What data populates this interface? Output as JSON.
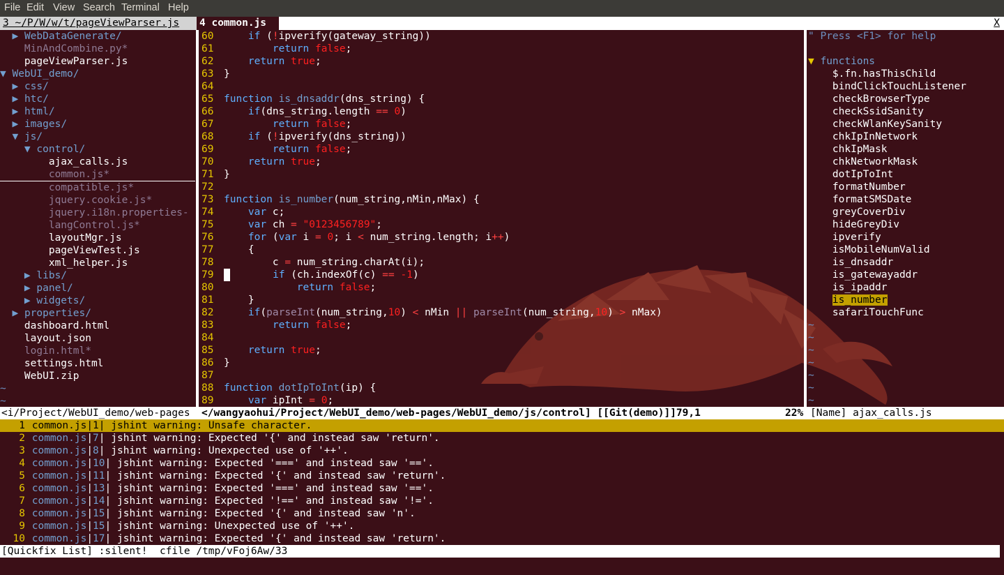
{
  "menubar": [
    "File",
    "Edit",
    "View",
    "Search",
    "Terminal",
    "Help"
  ],
  "tabline": {
    "tab1": "3 ~/P/W/w/t/pageViewParser.js",
    "tab2": "4 common.js",
    "close": "X"
  },
  "tree": [
    {
      "indent": "  ",
      "arrow": "▶ ",
      "text": "WebDataGenerate/",
      "kind": "dir"
    },
    {
      "indent": "    ",
      "arrow": "",
      "text": "MinAndCombine.py*",
      "kind": "mod"
    },
    {
      "indent": "    ",
      "arrow": "",
      "text": "pageViewParser.js",
      "kind": "file"
    },
    {
      "indent": "",
      "arrow": "▼ ",
      "text": "WebUI_demo/",
      "kind": "dir"
    },
    {
      "indent": "  ",
      "arrow": "▶ ",
      "text": "css/",
      "kind": "dir"
    },
    {
      "indent": "  ",
      "arrow": "▶ ",
      "text": "htc/",
      "kind": "dir"
    },
    {
      "indent": "  ",
      "arrow": "▶ ",
      "text": "html/",
      "kind": "dir"
    },
    {
      "indent": "  ",
      "arrow": "▶ ",
      "text": "images/",
      "kind": "dir"
    },
    {
      "indent": "  ",
      "arrow": "▼ ",
      "text": "js/",
      "kind": "dir"
    },
    {
      "indent": "    ",
      "arrow": "▼ ",
      "text": "control/",
      "kind": "dir"
    },
    {
      "indent": "        ",
      "arrow": "",
      "text": "ajax_calls.js",
      "kind": "file"
    },
    {
      "indent": "        ",
      "arrow": "",
      "text": "common.js*",
      "kind": "mod",
      "selected": true
    },
    {
      "indent": "        ",
      "arrow": "",
      "text": "compatible.js*",
      "kind": "mod"
    },
    {
      "indent": "        ",
      "arrow": "",
      "text": "jquery.cookie.js*",
      "kind": "mod"
    },
    {
      "indent": "        ",
      "arrow": "",
      "text": "jquery.i18n.properties-",
      "kind": "mod"
    },
    {
      "indent": "        ",
      "arrow": "",
      "text": "langControl.js*",
      "kind": "mod"
    },
    {
      "indent": "        ",
      "arrow": "",
      "text": "layoutMgr.js",
      "kind": "file"
    },
    {
      "indent": "        ",
      "arrow": "",
      "text": "pageViewTest.js",
      "kind": "file"
    },
    {
      "indent": "        ",
      "arrow": "",
      "text": "xml_helper.js",
      "kind": "file"
    },
    {
      "indent": "    ",
      "arrow": "▶ ",
      "text": "libs/",
      "kind": "dir"
    },
    {
      "indent": "    ",
      "arrow": "▶ ",
      "text": "panel/",
      "kind": "dir"
    },
    {
      "indent": "    ",
      "arrow": "▶ ",
      "text": "widgets/",
      "kind": "dir"
    },
    {
      "indent": "  ",
      "arrow": "▶ ",
      "text": "properties/",
      "kind": "dir"
    },
    {
      "indent": "    ",
      "arrow": "",
      "text": "dashboard.html",
      "kind": "file"
    },
    {
      "indent": "    ",
      "arrow": "",
      "text": "layout.json",
      "kind": "file"
    },
    {
      "indent": "    ",
      "arrow": "",
      "text": "login.html*",
      "kind": "mod"
    },
    {
      "indent": "    ",
      "arrow": "",
      "text": "settings.html",
      "kind": "file"
    },
    {
      "indent": "    ",
      "arrow": "",
      "text": "WebUI.zip",
      "kind": "file"
    },
    {
      "indent": "",
      "arrow": "",
      "text": "~",
      "kind": "tilde"
    },
    {
      "indent": "",
      "arrow": "",
      "text": "~",
      "kind": "tilde"
    }
  ],
  "editor": {
    "cursor_line": 79,
    "lines": [
      {
        "n": "60",
        "segs": [
          [
            "    ",
            ""
          ],
          [
            "if",
            "kw"
          ],
          [
            " (",
            ""
          ],
          [
            "!",
            "op"
          ],
          [
            "ipverify(gateway_string))",
            ""
          ]
        ]
      },
      {
        "n": "61",
        "segs": [
          [
            "        ",
            ""
          ],
          [
            "return",
            "kw"
          ],
          [
            " ",
            ""
          ],
          [
            "false",
            "bool"
          ],
          [
            ";",
            ""
          ]
        ]
      },
      {
        "n": "62",
        "segs": [
          [
            "    ",
            ""
          ],
          [
            "return",
            "kw"
          ],
          [
            " ",
            ""
          ],
          [
            "true",
            "bool"
          ],
          [
            ";",
            ""
          ]
        ]
      },
      {
        "n": "63",
        "segs": [
          [
            "}",
            ""
          ]
        ]
      },
      {
        "n": "64",
        "segs": []
      },
      {
        "n": "65",
        "segs": [
          [
            "function",
            "kw"
          ],
          [
            " ",
            ""
          ],
          [
            "is_dnsaddr",
            "fn"
          ],
          [
            "(dns_string) {",
            ""
          ]
        ]
      },
      {
        "n": "66",
        "segs": [
          [
            "    ",
            ""
          ],
          [
            "if",
            "kw"
          ],
          [
            "(dns_string.length ",
            ""
          ],
          [
            "==",
            "op"
          ],
          [
            " ",
            ""
          ],
          [
            "0",
            "num"
          ],
          [
            ")",
            ""
          ]
        ]
      },
      {
        "n": "67",
        "segs": [
          [
            "        ",
            ""
          ],
          [
            "return",
            "kw"
          ],
          [
            " ",
            ""
          ],
          [
            "false",
            "bool"
          ],
          [
            ";",
            ""
          ]
        ]
      },
      {
        "n": "68",
        "segs": [
          [
            "    ",
            ""
          ],
          [
            "if",
            "kw"
          ],
          [
            " (",
            ""
          ],
          [
            "!",
            "op"
          ],
          [
            "ipverify(dns_string))",
            ""
          ]
        ]
      },
      {
        "n": "69",
        "segs": [
          [
            "        ",
            ""
          ],
          [
            "return",
            "kw"
          ],
          [
            " ",
            ""
          ],
          [
            "false",
            "bool"
          ],
          [
            ";",
            ""
          ]
        ]
      },
      {
        "n": "70",
        "segs": [
          [
            "    ",
            ""
          ],
          [
            "return",
            "kw"
          ],
          [
            " ",
            ""
          ],
          [
            "true",
            "bool"
          ],
          [
            ";",
            ""
          ]
        ]
      },
      {
        "n": "71",
        "segs": [
          [
            "}",
            ""
          ]
        ]
      },
      {
        "n": "72",
        "segs": []
      },
      {
        "n": "73",
        "segs": [
          [
            "function",
            "kw"
          ],
          [
            " ",
            ""
          ],
          [
            "is_number",
            "fn"
          ],
          [
            "(num_string,nMin,nMax) {",
            ""
          ]
        ]
      },
      {
        "n": "74",
        "segs": [
          [
            "    ",
            ""
          ],
          [
            "var",
            "kw"
          ],
          [
            " c;",
            ""
          ]
        ]
      },
      {
        "n": "75",
        "segs": [
          [
            "    ",
            ""
          ],
          [
            "var",
            "kw"
          ],
          [
            " ch ",
            ""
          ],
          [
            "=",
            "op"
          ],
          [
            " ",
            ""
          ],
          [
            "\"0123456789\"",
            "str"
          ],
          [
            ";",
            ""
          ]
        ]
      },
      {
        "n": "76",
        "segs": [
          [
            "    ",
            ""
          ],
          [
            "for",
            "kw"
          ],
          [
            " (",
            ""
          ],
          [
            "var",
            "kw"
          ],
          [
            " i ",
            ""
          ],
          [
            "=",
            "op"
          ],
          [
            " ",
            ""
          ],
          [
            "0",
            "num"
          ],
          [
            "; i ",
            ""
          ],
          [
            "<",
            "op"
          ],
          [
            " num_string.length; i",
            ""
          ],
          [
            "++",
            "op"
          ],
          [
            ")",
            ""
          ]
        ]
      },
      {
        "n": "77",
        "segs": [
          [
            "    {",
            ""
          ]
        ]
      },
      {
        "n": "78",
        "segs": [
          [
            "        c ",
            ""
          ],
          [
            "=",
            "op"
          ],
          [
            " num_string.charAt(i);",
            ""
          ]
        ]
      },
      {
        "n": "79",
        "segs": [
          [
            "        ",
            ""
          ],
          [
            "if",
            "kw"
          ],
          [
            " (ch.indexOf(c) ",
            ""
          ],
          [
            "==",
            "op"
          ],
          [
            " ",
            ""
          ],
          [
            "-1",
            "num"
          ],
          [
            ")",
            ""
          ]
        ]
      },
      {
        "n": "80",
        "segs": [
          [
            "            ",
            ""
          ],
          [
            "return",
            "kw"
          ],
          [
            " ",
            ""
          ],
          [
            "false",
            "bool"
          ],
          [
            ";",
            ""
          ]
        ]
      },
      {
        "n": "81",
        "segs": [
          [
            "    }",
            ""
          ]
        ]
      },
      {
        "n": "82",
        "segs": [
          [
            "    ",
            ""
          ],
          [
            "if",
            "kw"
          ],
          [
            "(",
            ""
          ],
          [
            "parseInt",
            "gray"
          ],
          [
            "(num_string,",
            ""
          ],
          [
            "10",
            "num"
          ],
          [
            ") ",
            ""
          ],
          [
            "<",
            "op"
          ],
          [
            " nMin ",
            ""
          ],
          [
            "||",
            "op"
          ],
          [
            " ",
            ""
          ],
          [
            "parseInt",
            "gray"
          ],
          [
            "(num_string,",
            ""
          ],
          [
            "10",
            "num"
          ],
          [
            ") ",
            ""
          ],
          [
            ">",
            "op"
          ],
          [
            " nMax)",
            ""
          ]
        ]
      },
      {
        "n": "83",
        "segs": [
          [
            "        ",
            ""
          ],
          [
            "return",
            "kw"
          ],
          [
            " ",
            ""
          ],
          [
            "false",
            "bool"
          ],
          [
            ";",
            ""
          ]
        ]
      },
      {
        "n": "84",
        "segs": []
      },
      {
        "n": "85",
        "segs": [
          [
            "    ",
            ""
          ],
          [
            "return",
            "kw"
          ],
          [
            " ",
            ""
          ],
          [
            "true",
            "bool"
          ],
          [
            ";",
            ""
          ]
        ]
      },
      {
        "n": "86",
        "segs": [
          [
            "}",
            ""
          ]
        ]
      },
      {
        "n": "87",
        "segs": []
      },
      {
        "n": "88",
        "segs": [
          [
            "function",
            "kw"
          ],
          [
            " ",
            ""
          ],
          [
            "dotIpToInt",
            "fn"
          ],
          [
            "(ip) {",
            ""
          ]
        ]
      },
      {
        "n": "89",
        "segs": [
          [
            "    ",
            ""
          ],
          [
            "var",
            "kw"
          ],
          [
            " ipInt ",
            ""
          ],
          [
            "=",
            "op"
          ],
          [
            " ",
            ""
          ],
          [
            "0",
            "num"
          ],
          [
            ";",
            ""
          ]
        ]
      }
    ]
  },
  "tagbar": {
    "help": "\" Press <F1> for help",
    "header": "functions",
    "current": "is_number",
    "items": [
      "$.fn.hasThisChild",
      "bindClickTouchListener",
      "checkBrowserType",
      "checkSsidSanity",
      "checkWlanKeySanity",
      "chkIpInNetwork",
      "chkIpMask",
      "chkNetworkMask",
      "dotIpToInt",
      "formatNumber",
      "formatSMSDate",
      "greyCoverDiv",
      "hideGreyDiv",
      "ipverify",
      "isMobileNumValid",
      "is_dnsaddr",
      "is_gatewayaddr",
      "is_ipaddr",
      "is_number",
      "safariTouchFunc"
    ],
    "tilde_count": 7
  },
  "status": {
    "left": "<i/Project/WebUI_demo/web-pages",
    "middle": "</wangyaohui/Project/WebUI_demo/web-pages/WebUI_demo/js/control] [[Git(demo)]]79,1",
    "percent": "22%",
    "right": "[Name] ajax_calls.js"
  },
  "quickfix": [
    {
      "n": "1",
      "file": "common.js",
      "line": "1",
      "msg": " jshint warning: Unsafe character."
    },
    {
      "n": "2",
      "file": "common.js",
      "line": "7",
      "msg": " jshint warning: Expected '{' and instead saw 'return'."
    },
    {
      "n": "3",
      "file": "common.js",
      "line": "8",
      "msg": " jshint warning: Unexpected use of '++'."
    },
    {
      "n": "4",
      "file": "common.js",
      "line": "10",
      "msg": " jshint warning: Expected '===' and instead saw '=='."
    },
    {
      "n": "5",
      "file": "common.js",
      "line": "11",
      "msg": " jshint warning: Expected '{' and instead saw 'return'."
    },
    {
      "n": "6",
      "file": "common.js",
      "line": "13",
      "msg": " jshint warning: Expected '===' and instead saw '=='."
    },
    {
      "n": "7",
      "file": "common.js",
      "line": "14",
      "msg": " jshint warning: Expected '!==' and instead saw '!='."
    },
    {
      "n": "8",
      "file": "common.js",
      "line": "15",
      "msg": " jshint warning: Expected '{' and instead saw 'n'."
    },
    {
      "n": "9",
      "file": "common.js",
      "line": "15",
      "msg": " jshint warning: Unexpected use of '++'."
    },
    {
      "n": "10",
      "file": "common.js",
      "line": "17",
      "msg": " jshint warning: Expected '{' and instead saw 'return'."
    }
  ],
  "quickfix_status": "[Quickfix List] :silent!  cfile /tmp/vFoj6Aw/33"
}
